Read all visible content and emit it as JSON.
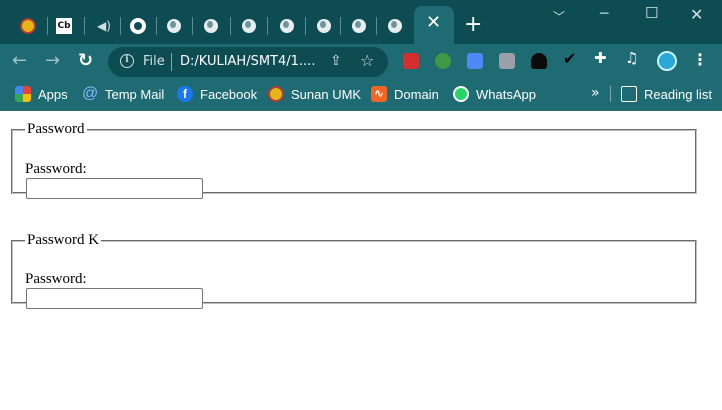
{
  "browser": {
    "address_scheme": "File",
    "address_url": "D:/KULIAH/SMT4/1....",
    "tabs": [
      {
        "icon": "university-seal-icon"
      },
      {
        "icon": "cb-icon",
        "text": "Cb"
      },
      {
        "icon": "speaker-audio-icon"
      },
      {
        "icon": "github-icon"
      },
      {
        "icon": "globe-icon"
      },
      {
        "icon": "globe-icon"
      },
      {
        "icon": "globe-icon"
      },
      {
        "icon": "globe-icon"
      },
      {
        "icon": "globe-icon"
      },
      {
        "icon": "globe-icon"
      },
      {
        "icon": "globe-icon"
      }
    ],
    "active_tab_close": "✕",
    "new_tab": "+",
    "bookmarks": [
      {
        "label": "Apps",
        "icon": "apps-grid-icon",
        "color": "#e94235"
      },
      {
        "label": "Temp Mail",
        "icon": "at-sign-icon",
        "color": "#5b8cff"
      },
      {
        "label": "Facebook",
        "icon": "facebook-icon",
        "color": "#1877f2"
      },
      {
        "label": "Sunan UMK",
        "icon": "university-seal-icon",
        "color": "#e7b416"
      },
      {
        "label": "Domain",
        "icon": "domain-icon",
        "color": "#f26522"
      },
      {
        "label": "WhatsApp",
        "icon": "whatsapp-icon",
        "color": "#25d366"
      }
    ],
    "bookmarks_overflow": "»",
    "reading_list": "Reading list"
  },
  "page": {
    "fieldsets": [
      {
        "legend": "Password",
        "label": "Password:",
        "value": ""
      },
      {
        "legend": "Password K",
        "label": "Password:",
        "value": ""
      }
    ]
  },
  "colors": {
    "tabstrip": "#0e4c53",
    "toolbar": "#1f6b73",
    "page_background": "#ffffff"
  }
}
